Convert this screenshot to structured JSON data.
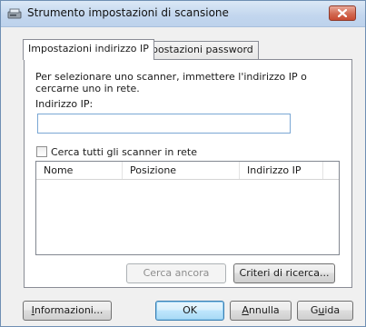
{
  "window": {
    "title": "Strumento impostazioni di scansione"
  },
  "tabs": [
    {
      "label": "Impostazioni indirizzo IP",
      "active": true
    },
    {
      "label": "Impostazioni password",
      "active": false
    }
  ],
  "panel": {
    "instructions": "Per selezionare uno scanner, immettere l'indirizzo IP o cercarne uno in rete.",
    "ip_label": "Indirizzo IP:",
    "ip_value": "",
    "search_all_label": "Cerca tutti gli scanner in rete",
    "search_all_checked": false,
    "columns": [
      "Nome",
      "Posizione",
      "Indirizzo IP"
    ],
    "rows": [],
    "search_again_label": "Cerca ancora",
    "criteria_label": "Criteri di ricerca..."
  },
  "footer": {
    "info_pre": "",
    "info_key": "I",
    "info_post": "nformazioni...",
    "ok_label": "OK",
    "cancel_key": "A",
    "cancel_post": "nnulla",
    "help_pre": "G",
    "help_key": "u",
    "help_post": "ida"
  },
  "colors": {
    "title_bar": "#c2d6ee",
    "close_button": "#c94b32",
    "default_button_border": "#3c7fb1"
  },
  "icons": {
    "title": "scanner-icon",
    "close": "close-icon"
  }
}
